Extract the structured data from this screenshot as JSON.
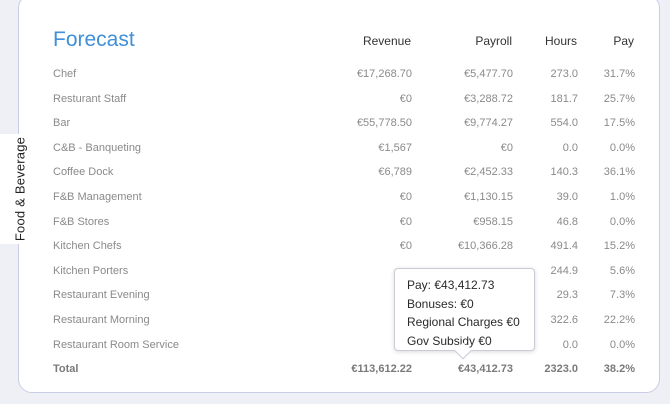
{
  "side_tab": "Food & Beverage",
  "title": "Forecast",
  "headers": {
    "revenue": "Revenue",
    "payroll": "Payroll",
    "hours": "Hours",
    "pay": "Pay"
  },
  "rows": [
    {
      "name": "Chef",
      "revenue": "€17,268.70",
      "payroll": "€5,477.70",
      "hours": "273.0",
      "pay": "31.7%"
    },
    {
      "name": "Resturant Staff",
      "revenue": "€0",
      "payroll": "€3,288.72",
      "hours": "181.7",
      "pay": "25.7%"
    },
    {
      "name": "Bar",
      "revenue": "€55,778.50",
      "payroll": "€9,774.27",
      "hours": "554.0",
      "pay": "17.5%"
    },
    {
      "name": "C&B - Banqueting",
      "revenue": "€1,567",
      "payroll": "€0",
      "hours": "0.0",
      "pay": "0.0%"
    },
    {
      "name": "Coffee Dock",
      "revenue": "€6,789",
      "payroll": "€2,452.33",
      "hours": "140.3",
      "pay": "36.1%"
    },
    {
      "name": "F&B Management",
      "revenue": "€0",
      "payroll": "€1,130.15",
      "hours": "39.0",
      "pay": "1.0%"
    },
    {
      "name": "F&B Stores",
      "revenue": "€0",
      "payroll": "€958.15",
      "hours": "46.8",
      "pay": "0.0%"
    },
    {
      "name": "Kitchen Chefs",
      "revenue": "€0",
      "payroll": "€10,366.28",
      "hours": "491.4",
      "pay": "15.2%"
    },
    {
      "name": "Kitchen Porters",
      "revenue": "",
      "payroll": "",
      "hours": "244.9",
      "pay": "5.6%"
    },
    {
      "name": "Restaurant Evening",
      "revenue": "",
      "payroll": "",
      "hours": "29.3",
      "pay": "7.3%"
    },
    {
      "name": "Restaurant Morning",
      "revenue": "",
      "payroll": "",
      "hours": "322.6",
      "pay": "22.2%"
    },
    {
      "name": "Restaurant Room Service",
      "revenue": "",
      "payroll": "",
      "hours": "0.0",
      "pay": "0.0%"
    }
  ],
  "total": {
    "name": "Total",
    "revenue": "€113,612.22",
    "payroll": "€43,412.73",
    "hours": "2323.0",
    "pay": "38.2%"
  },
  "tooltip": {
    "pay": "Pay: €43,412.73",
    "bonuses": "Bonuses: €0",
    "regional": "Regional Charges €0",
    "subsidy": "Gov Subsidy €0"
  }
}
